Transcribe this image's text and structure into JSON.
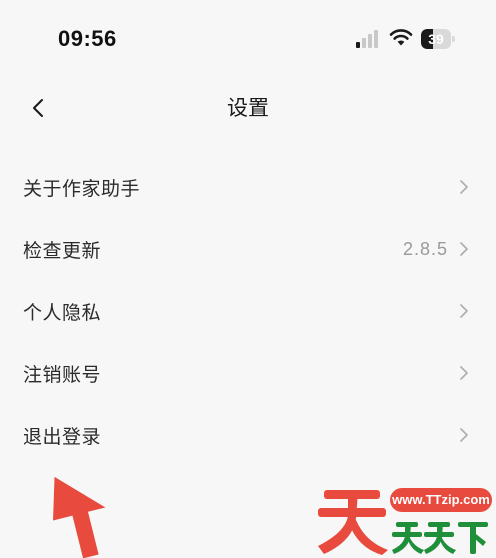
{
  "status_bar": {
    "time": "09:56",
    "battery_level": "39",
    "battery_fraction": 0.39,
    "signal_bars_active": 1,
    "signal_bars_total": 4,
    "icons": [
      "signal-icon",
      "wifi-icon",
      "battery-icon"
    ]
  },
  "nav": {
    "back_icon": "chevron-left-icon",
    "title": "设置"
  },
  "settings": {
    "items": [
      {
        "label": "关于作家助手",
        "value": "",
        "icon": "chevron-right-icon"
      },
      {
        "label": "检查更新",
        "value": "2.8.5",
        "icon": "chevron-right-icon"
      },
      {
        "label": "个人隐私",
        "value": "",
        "icon": "chevron-right-icon"
      },
      {
        "label": "注销账号",
        "value": "",
        "icon": "chevron-right-icon"
      },
      {
        "label": "退出登录",
        "value": "",
        "icon": "chevron-right-icon"
      }
    ]
  },
  "watermark": {
    "url": "www.TTzip.com",
    "arrow_icon": "arrow-up-icon",
    "logo_glyphs": "天天下載"
  },
  "colors": {
    "background": "#f7f7f7",
    "text": "#2b2b2b",
    "secondary_text": "#9a9a9a",
    "chevron": "#b0b0b0",
    "watermark_red": "#e84a3d",
    "watermark_green": "#1f8f3a"
  }
}
